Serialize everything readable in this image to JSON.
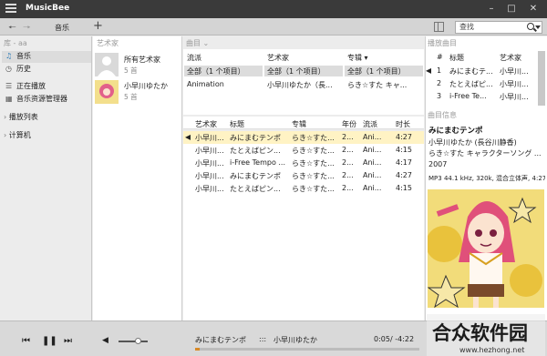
{
  "app": {
    "title": "MusicBee"
  },
  "toolbar": {
    "tab_music": "音乐",
    "add_tab": "+",
    "search_placeholder": "查找"
  },
  "left": {
    "header": "库 - aa",
    "items": [
      {
        "label": "音乐",
        "icon": "note-icon"
      },
      {
        "label": "历史",
        "icon": "history-icon"
      },
      {
        "label": "正在播放",
        "icon": "now-playing-icon"
      },
      {
        "label": "音乐资源管理器",
        "icon": "explorer-icon"
      }
    ],
    "sections": [
      {
        "label": "播放列表"
      },
      {
        "label": "计算机"
      }
    ]
  },
  "artists": {
    "header": "艺术家",
    "items": [
      {
        "name": "所有艺术家",
        "count": "5 首"
      },
      {
        "name": "小早川ゆたか",
        "count": "5 首"
      }
    ]
  },
  "browser": {
    "header": "曲目",
    "columns": [
      {
        "title": "流派",
        "items": [
          "全部（1 个项目）",
          "Animation"
        ]
      },
      {
        "title": "艺术家",
        "items": [
          "全部（1 个项目）",
          "小早川ゆたか（長..."
        ]
      },
      {
        "title": "专辑",
        "items": [
          "全部（1 个项目）",
          "らき☆すた キャ..."
        ]
      }
    ]
  },
  "tracks": {
    "columns": [
      "艺术家",
      "标题",
      "专辑",
      "年份",
      "流派",
      "时长"
    ],
    "rows": [
      [
        "小早川...",
        "みにまむテンポ",
        "らき☆すた...",
        "2...",
        "Ani...",
        "4:27"
      ],
      [
        "小早川...",
        "たとえばピン...",
        "らき☆すた...",
        "2...",
        "Ani...",
        "4:15"
      ],
      [
        "小早川...",
        "i-Free Tempo ...",
        "らき☆すた...",
        "2...",
        "Ani...",
        "4:17"
      ],
      [
        "小早川...",
        "みにまむテンポ",
        "らき☆すた...",
        "2...",
        "Ani...",
        "4:27"
      ],
      [
        "小早川...",
        "たとえばピン...",
        "らき☆すた...",
        "2...",
        "Ani...",
        "4:15"
      ]
    ]
  },
  "playing": {
    "header": "播放曲目",
    "columns": [
      "#",
      "标题",
      "艺术家"
    ],
    "rows": [
      [
        "1",
        "みにまむテ...",
        "小早川..."
      ],
      [
        "2",
        "たとえばピ...",
        "小早川..."
      ],
      [
        "3",
        "i-Free Te...",
        "小早川..."
      ]
    ]
  },
  "info": {
    "header": "曲目信息",
    "title": "みにまむテンポ",
    "artist": "小早川ゆたか (長谷川静香)",
    "album": "らき☆すた キャラクターソング ...",
    "year": "2007",
    "tech": "MP3 44.1 kHz, 320k, 混合立体声, 4:27"
  },
  "player": {
    "now": "みにまむテンポ",
    "sep": ":::",
    "artist": "小早川ゆたか",
    "time": "0:05/ -4:22",
    "progress_pct": 2,
    "volume_pct": 55
  },
  "watermark": {
    "brand": "合众软件园",
    "url": "www.hezhong.net"
  },
  "colors": {
    "accent": "#d88a28",
    "selection": "#fff3c4",
    "title_bar": "#3a3a3a"
  }
}
